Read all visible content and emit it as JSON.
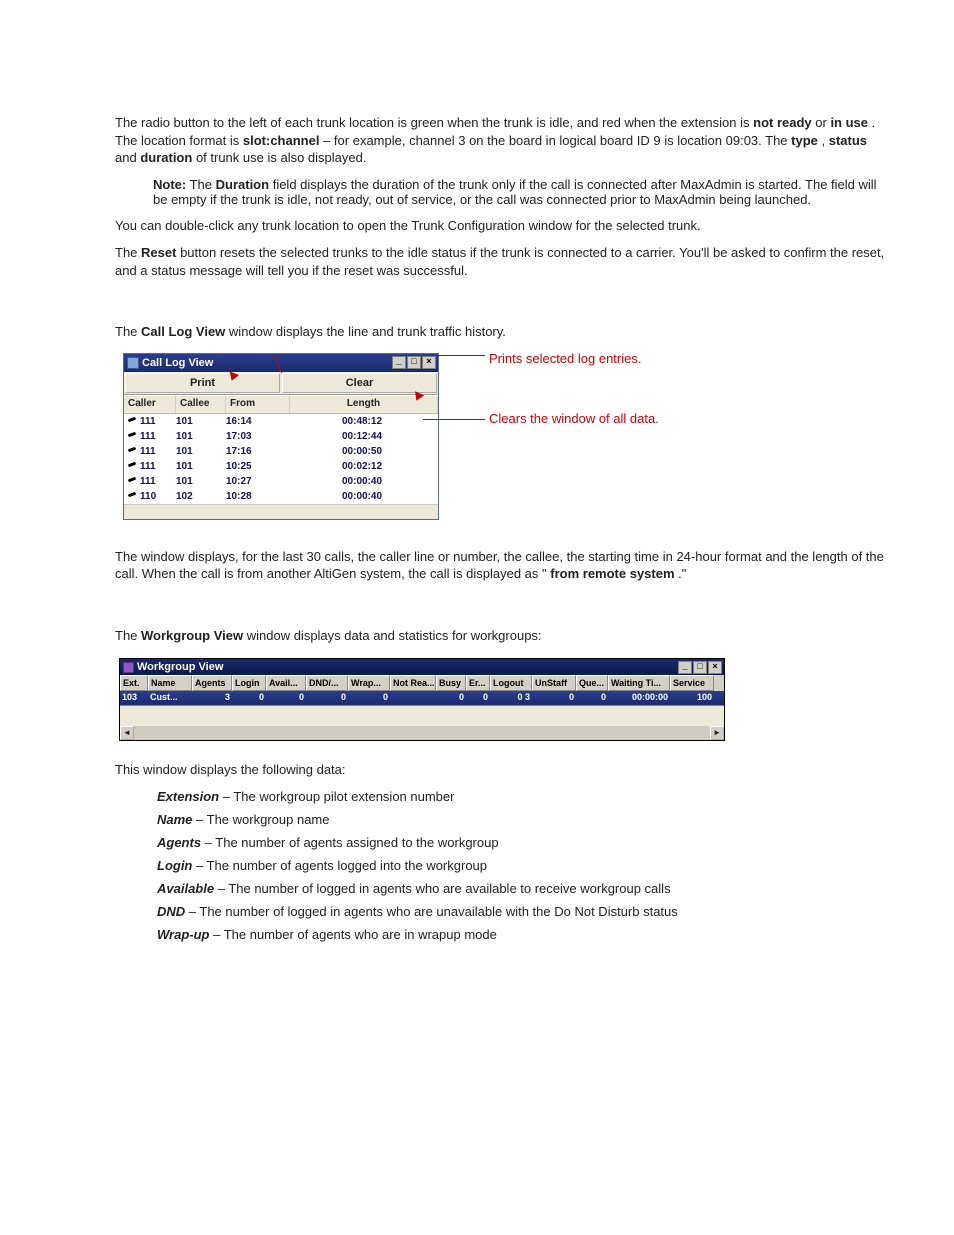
{
  "intro": {
    "p1a": "The radio button to the left of each trunk location is green when the trunk is idle, and red when the extension is ",
    "p1b": "not ready",
    "p1c": " or ",
    "p1d": "in use",
    "p1e": ". The location format is ",
    "p1f": "slot:channel",
    "p1g": " – for example, channel 3 on the board in logical board ID 9 is location 09:03. The ",
    "p1h": "type",
    "p1i": ", ",
    "p1j": "status",
    "p1k": " and ",
    "p1l": "duration",
    "p1m": " of trunk use is also displayed."
  },
  "note": {
    "label": "Note:",
    "body_a": "The ",
    "body_b": "Duration",
    "body_c": " field displays the duration of the trunk only if the call is connected after MaxAdmin is started. The field will be empty if the trunk is idle, not ready, out of service, or the call was connected prior to MaxAdmin being launched."
  },
  "p2": "You can double-click any trunk location to open the Trunk Configuration window for the selected trunk.",
  "p3": {
    "a": "The ",
    "b": "Reset",
    "c": " button resets the selected trunks to the idle status if the trunk is connected to a carrier. You'll be asked to confirm the reset, and a status message will tell you if the reset was successful."
  },
  "callLog": {
    "intro_a": "The ",
    "intro_b": "Call Log View",
    "intro_c": " window displays the line and trunk traffic history.",
    "window_title": "Call Log View",
    "print": "Print",
    "clear": "Clear",
    "hdr": {
      "caller": "Caller",
      "callee": "Callee",
      "from": "From",
      "length": "Length"
    },
    "rows": [
      {
        "caller": "111",
        "callee": "101",
        "from": "16:14",
        "length": "00:48:12"
      },
      {
        "caller": "111",
        "callee": "101",
        "from": "17:03",
        "length": "00:12:44"
      },
      {
        "caller": "111",
        "callee": "101",
        "from": "17:16",
        "length": "00:00:50"
      },
      {
        "caller": "111",
        "callee": "101",
        "from": "10:25",
        "length": "00:02:12"
      },
      {
        "caller": "111",
        "callee": "101",
        "from": "10:27",
        "length": "00:00:40"
      },
      {
        "caller": "110",
        "callee": "102",
        "from": "10:28",
        "length": "00:00:40"
      }
    ],
    "annot1": "Prints selected log entries.",
    "annot2": "Clears the window of all data."
  },
  "callLogDesc": {
    "a": "The window displays, for the last 30 calls, the caller line or number, the callee, the starting time in 24-hour format and the length of the call. When the call is from another AltiGen system, the call is displayed as \"",
    "b": "from remote system",
    "c": ".\""
  },
  "workgroup": {
    "intro_a": "The ",
    "intro_b": "Workgroup View",
    "intro_c": " window displays data and statistics for workgroups:",
    "title": "Workgroup View",
    "hdr": {
      "ext": "Ext.",
      "name": "Name",
      "agents": "Agents",
      "login": "Login",
      "avail": "Avail...",
      "dnd": "DND/...",
      "wrap": "Wrap...",
      "notrea": "Not Rea...",
      "busy": "Busy",
      "er": "Er...",
      "logout": "Logout",
      "unstaff": "UnStaff",
      "que": "Que...",
      "waiting": "Waiting Ti...",
      "service": "Service"
    },
    "row": {
      "ext": "103",
      "name": "Cust...",
      "agents": "3",
      "login": "0",
      "avail": "0",
      "dnd": "0",
      "wrap": "0",
      "notrea": "",
      "busy": "0",
      "er": "0",
      "logout": "0  3",
      "unstaff": "0",
      "que": "0",
      "waiting": "00:00:00",
      "service": "100"
    }
  },
  "fieldsIntro": "This window displays the following data:",
  "fields": [
    {
      "term": "Extension",
      "desc": " – The workgroup pilot extension number"
    },
    {
      "term": "Name",
      "desc": " – The workgroup name"
    },
    {
      "term": "Agents",
      "desc": " – The number of agents assigned to the workgroup"
    },
    {
      "term": "Login",
      "desc": " – The number of agents logged into the workgroup"
    },
    {
      "term": "Available",
      "desc": " – The number of logged in agents who are available to receive workgroup calls"
    },
    {
      "term": "DND",
      "desc": " – The number of logged in agents who are unavailable with the Do Not Disturb status"
    },
    {
      "term": "Wrap-up",
      "desc": " – The number of agents who are in wrapup mode"
    }
  ]
}
